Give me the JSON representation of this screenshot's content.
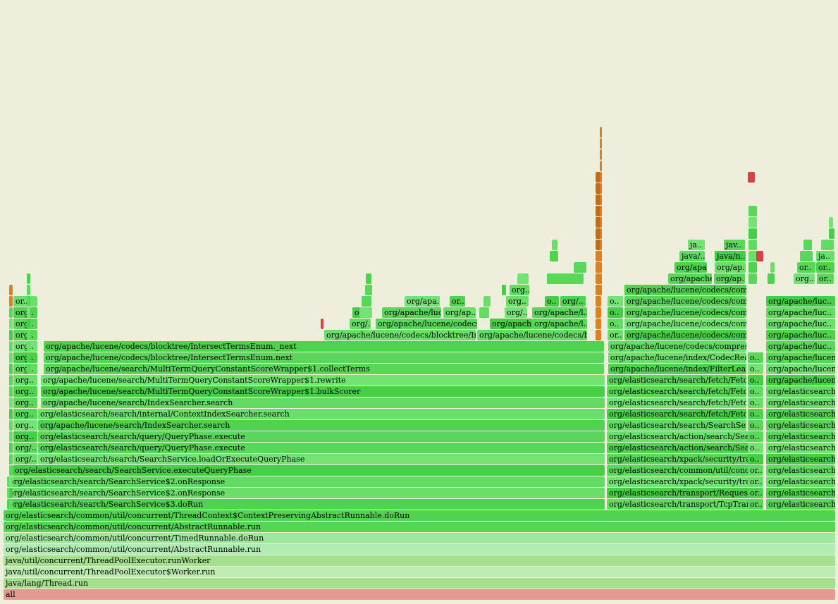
{
  "colors": {
    "background": "#eeeedd",
    "root": "#e39a92",
    "thread": "#a5e08f",
    "java": "#9ee49e",
    "app": "#53d653",
    "hot": "#d64343",
    "native": "#e0801c"
  },
  "root_label": "all",
  "stack_main": [
    "java/lang/Thread.run",
    "java/util/concurrent/ThreadPoolExecutor$Worker.run",
    "java/util/concurrent/ThreadPoolExecutor.runWorker",
    "org/elasticsearch/common/util/concurrent/AbstractRunnable.run",
    "org/elasticsearch/common/util/concurrent/TimedRunnable.doRun",
    "org/elasticsearch/common/util/concurrent/AbstractRunnable.run",
    "org/elasticsearch/common/util/concurrent/ThreadContext$ContextPreservingAbstractRunnable.doRun"
  ],
  "stack_left": [
    "org/elasticsearch/search/SearchService$3.doRun",
    "org/elasticsearch/search/SearchService$2.onResponse",
    "org/elasticsearch/search/SearchService$2.onResponse",
    "org/elasticsearch/search/SearchService.executeQueryPhase",
    "org/elasticsearch/search/SearchService.loadOrExecuteQueryPhase",
    "org/elasticsearch/search/query/QueryPhase.execute",
    "org/elasticsearch/search/query/QueryPhase.execute",
    "org/apache/lucene/search/IndexSearcher.search",
    "org/elasticsearch/search/internal/ContextIndexSearcher.search",
    "org/apache/lucene/search/IndexSearcher.search",
    "org/apache/lucene/search/MultiTermQueryConstantScoreWrapper$1.bulkScorer",
    "org/apache/lucene/search/MultiTermQueryConstantScoreWrapper$1.rewrite",
    "org/apache/lucene/search/MultiTermQueryConstantScoreWrapper$1.collectTerms",
    "org/apache/lucene/codecs/blocktree/IntersectTermsEnum.next",
    "org/apache/lucene/codecs/blocktree/IntersectTermsEnum._next"
  ],
  "stack_mid_left": [
    "org/apache/lucene/codecs/blocktree/Inters..",
    "org/..",
    "org..",
    "org/apa.."
  ],
  "stack_mid_codecs": [
    "org/apache/lucene/codecs/..",
    "org/apache/luc..",
    "or.."
  ],
  "stack_mid_ap": "org/ap..",
  "stack_mid_right": [
    "org/apache/lucene/codecs/blo..",
    "org/apach..",
    "org/.."
  ],
  "stack_mid_far": [
    "org/apache/l..",
    "org/apache/l..",
    "org/.."
  ],
  "stack_mid_small": [
    "org..",
    "org.."
  ],
  "stack_mid_o": "o..",
  "stack_fetch": [
    "org/elasticsearch/transport/TcpTransport$R..",
    "org/elasticsearch/transport/RequestHandler..",
    "org/elasticsearch/xpack/security/transport/S..",
    "org/elasticsearch/common/util/concurrent/A..",
    "org/elasticsearch/xpack/security/transport/S..",
    "org/elasticsearch/action/search/SearchTrans..",
    "org/elasticsearch/action/search/SearchTrans..",
    "org/elasticsearch/search/SearchService..",
    "org/elasticsearch/search/fetch/FetchPh..",
    "org/elasticsearch/search/fetch/FetchPh..",
    "org/elasticsearch/search/fetch/FetchPh..",
    "org/elasticsearch/search/fetch/FetchPh..",
    "org/apache/lucene/index/FilterLeafRe..",
    "org/apache/lucene/index/CodecReader..",
    "org/apache/lucene/codecs/compressin..",
    "org/apache/lucene/codecs/compre..",
    "org/apache/lucene/codecs/compr..",
    "org/apache/lucene/codecs/compr..",
    "org/apache/lucene/codecs/compr..",
    "org/apache/lucene/codecs/compr.."
  ],
  "stack_fetch_left": [
    "or..",
    "o..",
    "o..",
    "o.."
  ],
  "stack_fetch_top": [
    "org/apache..",
    "org/ap..",
    "org/apa..",
    "org/ap..",
    "java/..",
    "java/n..",
    "ja..",
    "jav.."
  ],
  "stack_right": [
    "org/elasticsearch/..",
    "org/elasticsearch/..",
    "org/elasticsearch..",
    "org/elasticsearch/..",
    "org/elasticsearch..",
    "org/elasticsearch/..",
    "org/elasticsearch/..",
    "org/elasticsearch/..",
    "org/elasticsearch/..",
    "org/elasticsearch/..",
    "org/elasticsearch/..",
    "org/apache/lucene..",
    "org/apache/lucene..",
    "org/apache/lucen..",
    "org/apache/luc..",
    "org/apache/luc..",
    "org/apache/luc..",
    "org/apache/luc..",
    "org/apache/luc.."
  ],
  "stack_right_top": [
    "org..",
    "or..",
    "or..",
    "or..",
    "ja..",
    "ja.."
  ],
  "stack_narrow_o": [
    "or..",
    "or..",
    "or..",
    "or..",
    "o..",
    "o..",
    "o..",
    "o..",
    "o..",
    "o..",
    "o..",
    "o..",
    "o..",
    "o.."
  ],
  "stack_left_thin": [
    "org/..",
    "org/..",
    "org..",
    "org..",
    "org..",
    "org..",
    "org..",
    "org..",
    "org..",
    "org..",
    "org..",
    "org..",
    "org..",
    "org..",
    "or.."
  ]
}
